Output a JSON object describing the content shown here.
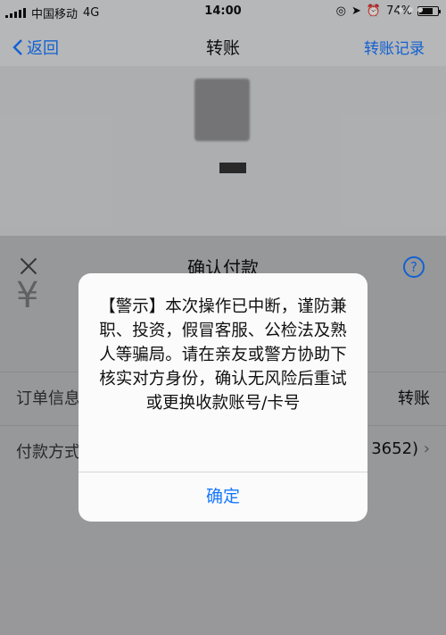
{
  "status_bar": {
    "carrier": "中国移动",
    "network": "4G",
    "time": "14:00",
    "battery": "74%",
    "battery_level": 0.74
  },
  "nav": {
    "back_label": "返回",
    "title": "转账",
    "right_label": "转账记录"
  },
  "sheet": {
    "title": "确认付款",
    "help_label": "?",
    "amount": "¥",
    "order_label": "订单信息",
    "order_value": "转账",
    "payment_label": "付款方式",
    "payment_value": "3652)"
  },
  "dialog": {
    "message": "【警示】本次操作已中断，谨防兼职、投资，假冒客服、公检法及熟人等骗局。请在亲友或警方协助下核实对方身份，确认无风险后重试或更换收款账号/卡号",
    "confirm_label": "确定"
  },
  "colors": {
    "accent": "#1677ff"
  }
}
